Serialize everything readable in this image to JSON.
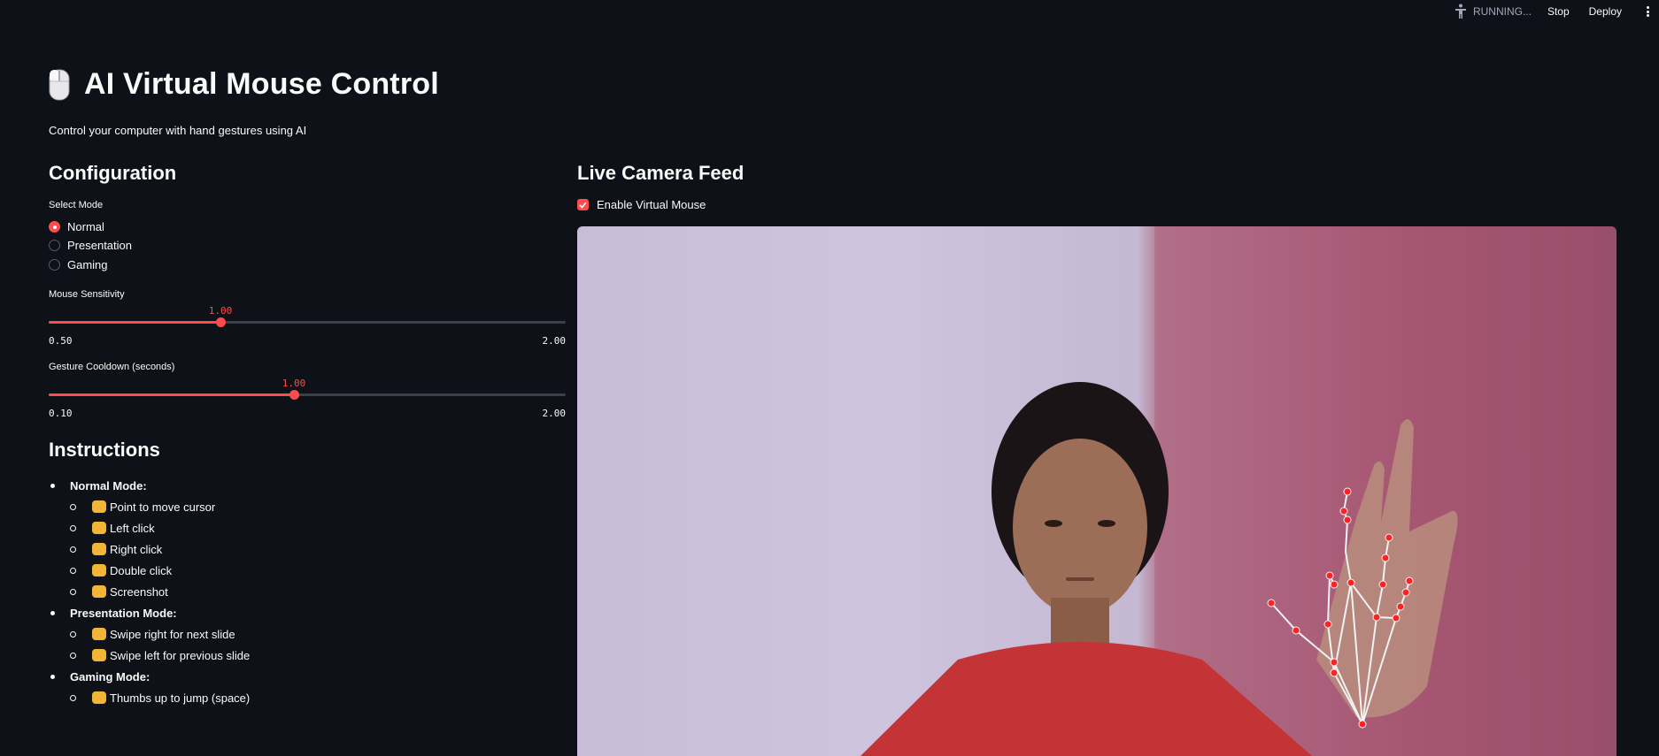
{
  "toolbar": {
    "status": "RUNNING...",
    "stop": "Stop",
    "deploy": "Deploy"
  },
  "header": {
    "title": "AI Virtual Mouse Control",
    "subtitle": "Control your computer with hand gestures using AI"
  },
  "config": {
    "heading": "Configuration",
    "mode_label": "Select Mode",
    "modes": [
      "Normal",
      "Presentation",
      "Gaming"
    ],
    "selected_mode": "Normal",
    "sensitivity": {
      "label": "Mouse Sensitivity",
      "value": "1.00",
      "min": "0.50",
      "max": "2.00",
      "fraction": 0.333
    },
    "cooldown": {
      "label": "Gesture Cooldown (seconds)",
      "value": "1.00",
      "min": "0.10",
      "max": "2.00",
      "fraction": 0.474
    }
  },
  "instructions": {
    "heading": "Instructions",
    "sections": [
      {
        "title": "Normal Mode:",
        "items": [
          "Point to move cursor",
          "Left click",
          "Right click",
          "Double click",
          "Screenshot"
        ]
      },
      {
        "title": "Presentation Mode:",
        "items": [
          "Swipe right for next slide",
          "Swipe left for previous slide"
        ]
      },
      {
        "title": "Gaming Mode:",
        "items": [
          "Thumbs up to jump (space)"
        ]
      }
    ]
  },
  "camera": {
    "heading": "Live Camera Feed",
    "enable_label": "Enable Virtual Mouse",
    "enabled": true
  },
  "colors": {
    "background": "#0e1117",
    "accent": "#ff4b4b",
    "text": "#fafafa"
  }
}
